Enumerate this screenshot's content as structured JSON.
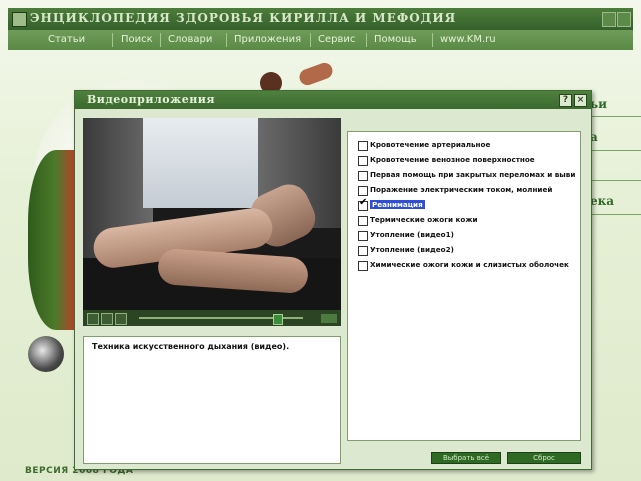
{
  "app": {
    "title": "ЭНЦИКЛОПЕДИЯ ЗДОРОВЬЯ КИРИЛЛА И МЕФОДИЯ",
    "version": "ВЕРСИЯ 2008 ГОДА",
    "menu": [
      "Статьи",
      "Поиск",
      "Словари",
      "Приложения",
      "Сервис",
      "Помощь",
      "www.KM.ru"
    ],
    "side_fragments": [
      "ьи",
      "а",
      "ека"
    ]
  },
  "dialog": {
    "title": "Видеоприложения",
    "help_label": "?",
    "close_label": "×",
    "description": "Техника искусственного дыхания (видео).",
    "items": [
      {
        "label": "Кровотечение артериальное",
        "checked": false,
        "selected": false
      },
      {
        "label": "Кровотечение венозное поверхностное",
        "checked": false,
        "selected": false
      },
      {
        "label": "Первая помощь при закрытых переломах и выви",
        "checked": false,
        "selected": false
      },
      {
        "label": "Поражение электрическим током, молнией",
        "checked": false,
        "selected": false
      },
      {
        "label": "Реанимация",
        "checked": true,
        "selected": true
      },
      {
        "label": "Термические ожоги кожи",
        "checked": false,
        "selected": false
      },
      {
        "label": "Утопление (видео1)",
        "checked": false,
        "selected": false
      },
      {
        "label": "Утопление (видео2)",
        "checked": false,
        "selected": false
      },
      {
        "label": "Химические ожоги кожи и слизистых оболочек",
        "checked": false,
        "selected": false
      }
    ],
    "select_all_label": "Выбрать всё",
    "reset_label": "Сброс",
    "playback_progress": 0.82
  }
}
